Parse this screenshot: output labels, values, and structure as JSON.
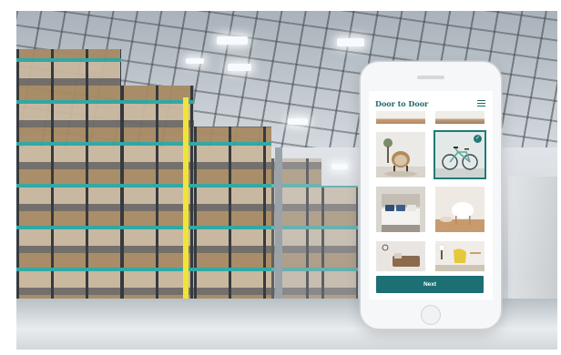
{
  "app": {
    "brand": "Door to Door",
    "menu_icon": "hamburger-menu-icon",
    "next_label": "Next",
    "check_icon": "checkmark-icon",
    "accent_color": "#1c6f73"
  },
  "photo_grid": {
    "tiles": [
      {
        "subject": "wood-shelf",
        "selected": false
      },
      {
        "subject": "wood-shelf",
        "selected": false
      },
      {
        "subject": "rattan-chair",
        "selected": false
      },
      {
        "subject": "bicycle",
        "selected": true
      },
      {
        "subject": "bedroom",
        "selected": false
      },
      {
        "subject": "white-chair",
        "selected": false
      },
      {
        "subject": "living-room",
        "selected": false
      },
      {
        "subject": "yellow-chair",
        "selected": false
      }
    ]
  }
}
